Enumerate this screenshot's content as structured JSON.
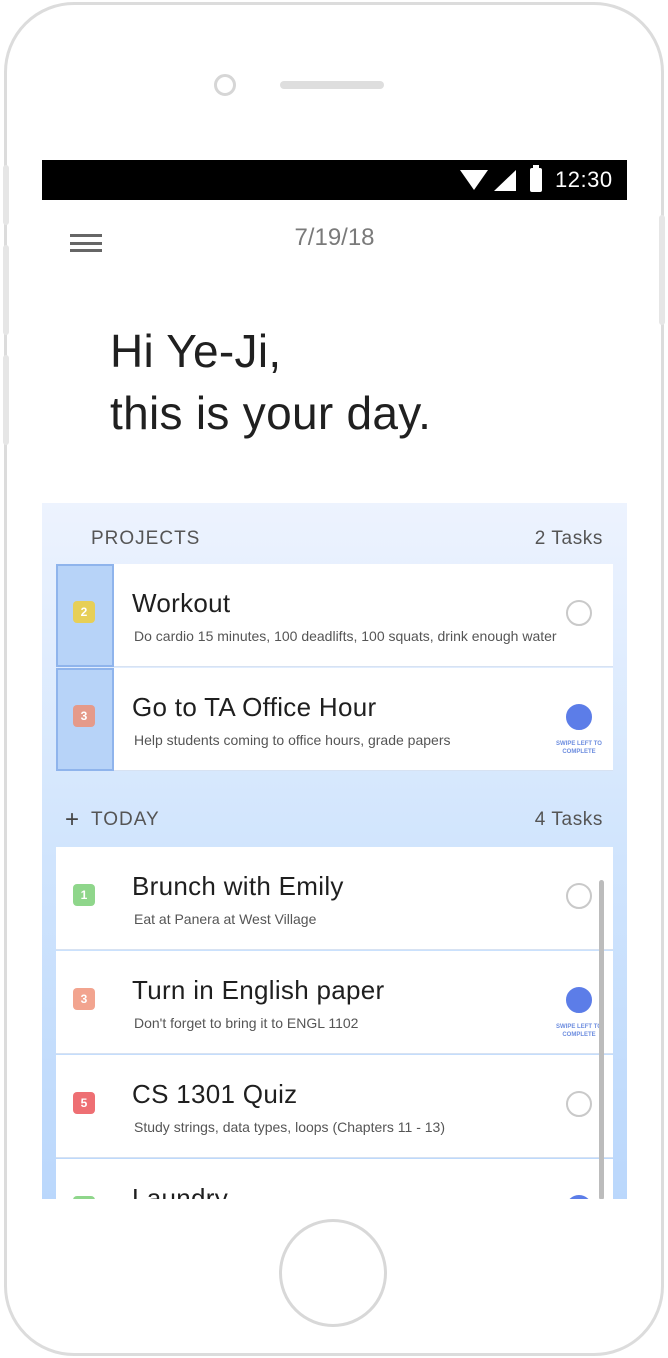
{
  "status_bar": {
    "time": "12:30",
    "icons": [
      "wifi-icon",
      "signal-icon",
      "battery-icon"
    ]
  },
  "header": {
    "menu_icon": "hamburger-menu-icon",
    "date": "7/19/18"
  },
  "greeting": {
    "line1": "Hi Ye-Ji,",
    "line2": "this is your day."
  },
  "projects": {
    "title": "PROJECTS",
    "count": "2 Tasks",
    "tasks": [
      {
        "badge": "2",
        "badge_color": "#e7cf57",
        "title": "Workout",
        "description": "Do cardio 15 minutes, 100 deadlifts, 100 squats, drink enough water",
        "done": false
      },
      {
        "badge": "3",
        "badge_color": "#e59a8a",
        "title": "Go to TA Office Hour",
        "description": "Help students coming to office hours, grade papers",
        "done": true,
        "hint": "SWIPE LEFT TO COMPLETE"
      }
    ]
  },
  "today": {
    "title": "TODAY",
    "add_icon": "plus-icon",
    "count": "4 Tasks",
    "tasks": [
      {
        "badge": "1",
        "badge_color": "#8fd68b",
        "title": "Brunch with Emily",
        "description": "Eat at Panera at West Village",
        "done": false
      },
      {
        "badge": "3",
        "badge_color": "#f2a48f",
        "title": "Turn in English paper",
        "description": "Don't forget to bring it to ENGL 1102",
        "done": true,
        "hint": "SWIPE LEFT TO COMPLETE"
      },
      {
        "badge": "5",
        "badge_color": "#ee6f73",
        "title": "CS 1301 Quiz",
        "description": "Study strings, data types, loops (Chapters 11 - 13)",
        "done": false
      },
      {
        "badge": "",
        "badge_color": "#8fd68b",
        "title": "Laundry",
        "description": "",
        "done": true
      }
    ]
  },
  "colors": {
    "accent": "#5c7de8",
    "panel_top": "#edf3fe",
    "panel_bottom": "#bad7fc"
  }
}
